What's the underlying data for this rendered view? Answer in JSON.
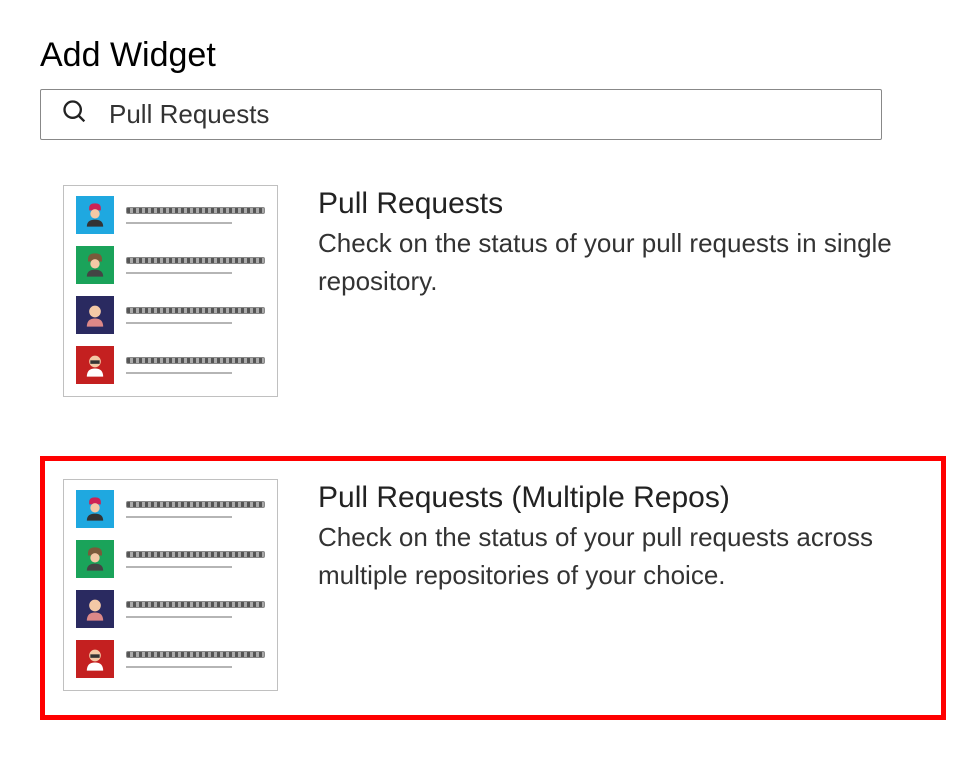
{
  "header": {
    "title": "Add Widget"
  },
  "search": {
    "value": "Pull Requests"
  },
  "widgets": [
    {
      "title": "Pull Requests",
      "description": "Check on the status of your pull requests in single repository.",
      "highlighted": false
    },
    {
      "title": "Pull Requests (Multiple Repos)",
      "description": "Check on the status of your pull requests across multiple repositories of your choice.",
      "highlighted": true
    }
  ]
}
